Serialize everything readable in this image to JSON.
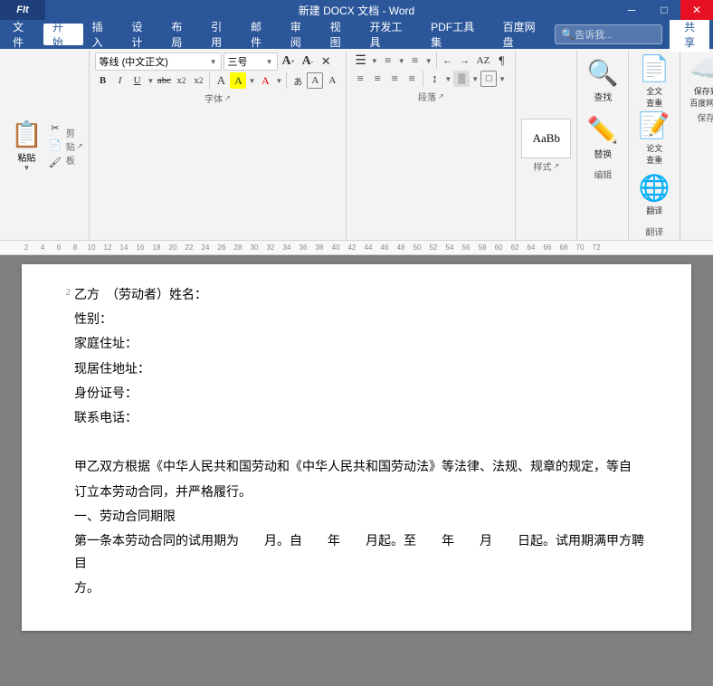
{
  "titleBar": {
    "fitLabel": "FIt",
    "title": "新建 DOCX 文档 - Word",
    "windowControls": [
      "─",
      "□",
      "✕"
    ]
  },
  "menuBar": {
    "items": [
      "文件",
      "开始",
      "插入",
      "设计",
      "布局",
      "引用",
      "邮件",
      "审阅",
      "视图",
      "开发工具",
      "PDF工具集",
      "百度网盘"
    ],
    "activeItem": "开始",
    "searchPlaceholder": "告诉我...",
    "shareLabel": "共享"
  },
  "ribbon": {
    "clipboard": {
      "pasteLabel": "粘贴",
      "label": "剪贴板",
      "buttons": [
        "格式刷"
      ]
    },
    "font": {
      "fontName": "等线 (中文正文)",
      "fontSize": "三号",
      "label": "字体",
      "boldLabel": "B",
      "italicLabel": "I",
      "underlineLabel": "U",
      "strikeLabel": "abc",
      "subLabel": "x₂",
      "supLabel": "x²",
      "fontColorLabel": "A",
      "highlightLabel": "A",
      "caseLabel": "A",
      "growLabel": "A↑",
      "shrinkLabel": "A↓",
      "clearLabel": "✕",
      "phoneticLabel": "あ"
    },
    "paragraph": {
      "label": "段落",
      "listButtons": [
        "≡",
        "≡↑",
        "≡↓"
      ],
      "alignButtons": [
        "≡L",
        "≡C",
        "≡J",
        "≡R"
      ],
      "indentButtons": [
        "←",
        "→"
      ],
      "spacingLabel": "行间距",
      "sortLabel": "排序",
      "borderLabel": "边框",
      "shadingLabel": "底纹"
    },
    "styles": {
      "label": "样式",
      "previewText": "AaBb",
      "expandLabel": "↕"
    },
    "editing": {
      "label": "编辑",
      "findLabel": "查找",
      "replaceLabel": "替换"
    },
    "translation": {
      "label": "翻译",
      "fullText": "全文\n查重",
      "paper": "论文\n查重",
      "translateLabel": "翻译"
    },
    "save": {
      "label": "保存",
      "cloudLabel": "保存到\n百度网盘"
    }
  },
  "ruler": {
    "marks": [
      "2",
      "4",
      "6",
      "8",
      "10",
      "12",
      "14",
      "16",
      "18",
      "20",
      "22",
      "24",
      "26",
      "28",
      "30",
      "32",
      "34",
      "36",
      "38",
      "40",
      "42",
      "44",
      "46",
      "48",
      "50",
      "52",
      "54",
      "56",
      "58",
      "60",
      "62",
      "64",
      "66",
      "68",
      "70",
      "72"
    ]
  },
  "document": {
    "lines": [
      {
        "text": "乙方　（劳动者）姓名：",
        "indent": false
      },
      {
        "text": "性别：",
        "indent": false
      },
      {
        "text": "家庭住址：",
        "indent": false
      },
      {
        "text": "现居住地址：",
        "indent": false
      },
      {
        "text": "身份证号：",
        "indent": false
      },
      {
        "text": "联系电话：",
        "indent": false
      },
      {
        "text": "",
        "indent": false
      },
      {
        "text": "甲乙双方根据《中华人民共和国劳动和《中华人民共和国劳动法》等法律、法规、规章的规定，等自订立本劳动合同，并严格履行。",
        "indent": false,
        "multiline": true,
        "lines": [
          "甲乙双方根据《中华人民共和国劳动和《中华人民共和国劳动法》等法律、法规、规章的规定，等自",
          "订立本劳动合同，并严格履行。"
        ]
      },
      {
        "text": "一、劳动合同期限",
        "indent": false
      },
      {
        "text": "第一条本劳动合同的试用期为　　月。自　　年　　月起。至　　年　　月　　日起。试用期满甲方聘目方。",
        "indent": false,
        "multiline": true,
        "lines": [
          "第一条本劳动合同的试用期为　　月。自　　年　　月起。至　　年　　月　　日起。试用期满甲方聘目",
          "方。"
        ]
      }
    ]
  }
}
